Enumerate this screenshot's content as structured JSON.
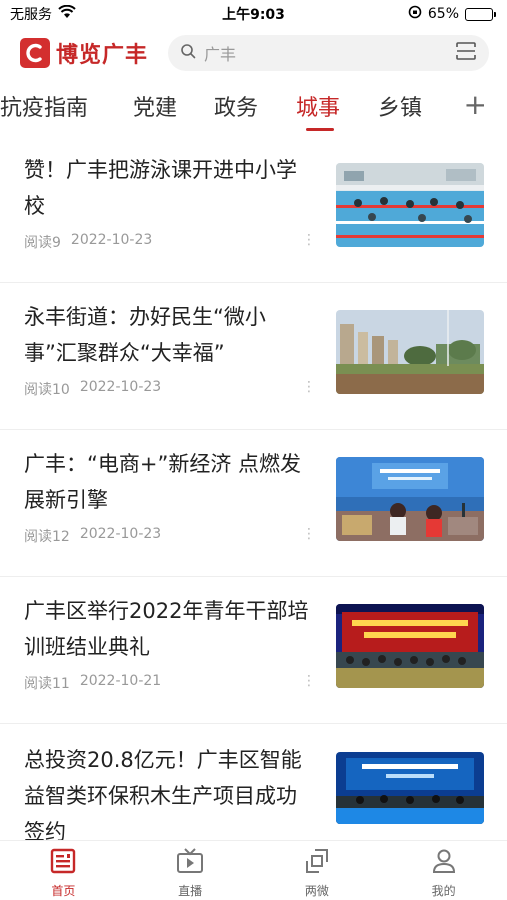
{
  "status_bar": {
    "carrier": "无服务",
    "time": "上午9:03",
    "battery": "65%",
    "battery_level": 0.65
  },
  "header": {
    "logo_text": "博览广丰",
    "search_placeholder": "广丰"
  },
  "tabs": [
    {
      "label": "抗疫指南",
      "active": false
    },
    {
      "label": "党建",
      "active": false
    },
    {
      "label": "政务",
      "active": false
    },
    {
      "label": "城事",
      "active": true
    },
    {
      "label": "乡镇",
      "active": false
    }
  ],
  "tab_add_label": "+",
  "news": [
    {
      "title": "赞！广丰把游泳课开进中小学校",
      "reads": "阅读9",
      "date": "2022-10-23",
      "thumb": "swimming-pool-photo"
    },
    {
      "title": "永丰街道：办好民生“微小事”汇聚群众“大幸福”",
      "reads": "阅读10",
      "date": "2022-10-23",
      "thumb": "sports-field-photo"
    },
    {
      "title": "广丰：“电商+”新经济 点燃发展新引擎",
      "reads": "阅读12",
      "date": "2022-10-23",
      "thumb": "livestream-ecommerce-photo"
    },
    {
      "title": "广丰区举行2022年青年干部培训班结业典礼",
      "reads": "阅读11",
      "date": "2022-10-21",
      "thumb": "ceremony-stage-photo"
    },
    {
      "title": "总投资20.8亿元！广丰区智能益智类环保积木生产项目成功签约",
      "reads": "",
      "date": "",
      "thumb": "signing-ceremony-photo"
    }
  ],
  "more_glyph": "⋮",
  "bottom_nav": [
    {
      "label": "首页",
      "icon": "home-news-icon",
      "active": true
    },
    {
      "label": "直播",
      "icon": "tv-live-icon",
      "active": false
    },
    {
      "label": "两微",
      "icon": "share-icon",
      "active": false
    },
    {
      "label": "我的",
      "icon": "user-icon",
      "active": false
    }
  ],
  "colors": {
    "accent": "#c62828",
    "muted": "#999999"
  }
}
